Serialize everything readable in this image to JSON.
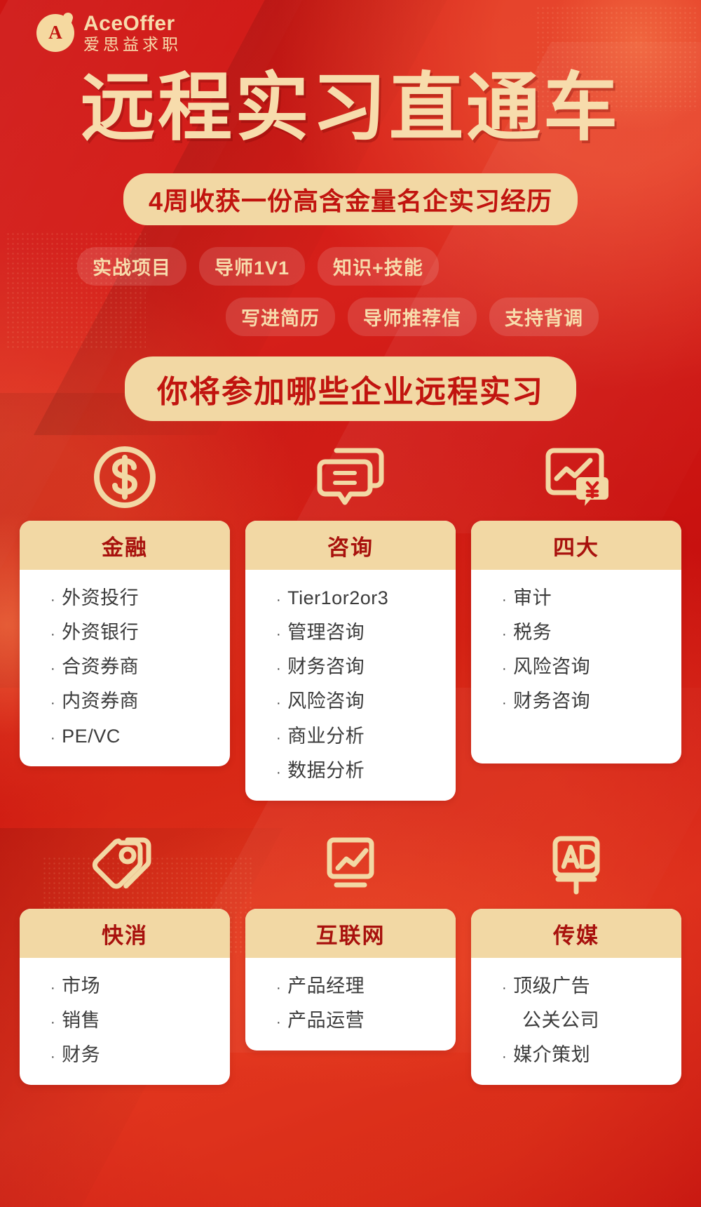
{
  "brand": {
    "mark_letter": "A",
    "name_en": "AceOffer",
    "name_cn": "爱思益求职"
  },
  "hero": {
    "main_title": "远程实习直通车",
    "subtitle": "4周收获一份高含金量名企实习经历",
    "tags_row1": [
      "实战项目",
      "导师1V1",
      "知识+技能"
    ],
    "tags_row2": [
      "写进简历",
      "导师推荐信",
      "支持背调"
    ]
  },
  "section": {
    "headline": "你将参加哪些企业远程实习"
  },
  "colors": {
    "background_red": "#d11a17",
    "cream": "#f2d8a4",
    "gold_text": "#f7dcac",
    "card_title_red": "#a8110d",
    "item_text": "#3b3b3b",
    "card_bg": "#ffffff"
  },
  "cards": [
    {
      "icon": "dollar-circle-icon",
      "title": "金融",
      "items": [
        {
          "text": "外资投行",
          "bullet": true
        },
        {
          "text": "外资银行",
          "bullet": true
        },
        {
          "text": "合资券商",
          "bullet": true
        },
        {
          "text": "内资券商",
          "bullet": true
        },
        {
          "text": "PE/VC",
          "bullet": true
        }
      ]
    },
    {
      "icon": "chat-bubbles-icon",
      "title": "咨询",
      "items": [
        {
          "text": "Tier1or2or3",
          "bullet": true
        },
        {
          "text": "管理咨询",
          "bullet": true
        },
        {
          "text": "财务咨询",
          "bullet": true
        },
        {
          "text": "风险咨询",
          "bullet": true
        },
        {
          "text": "商业分析",
          "bullet": true
        },
        {
          "text": "数据分析",
          "bullet": true
        }
      ]
    },
    {
      "icon": "chart-yen-icon",
      "title": "四大",
      "items": [
        {
          "text": "审计",
          "bullet": true
        },
        {
          "text": "税务",
          "bullet": true
        },
        {
          "text": "风险咨询",
          "bullet": true
        },
        {
          "text": "财务咨询",
          "bullet": true
        }
      ]
    },
    {
      "icon": "price-tag-icon",
      "title": "快消",
      "items": [
        {
          "text": "市场",
          "bullet": true
        },
        {
          "text": "销售",
          "bullet": true
        },
        {
          "text": "财务",
          "bullet": true
        }
      ]
    },
    {
      "icon": "chart-board-icon",
      "title": "互联网",
      "items": [
        {
          "text": "产品经理",
          "bullet": true
        },
        {
          "text": "产品运营",
          "bullet": true
        }
      ]
    },
    {
      "icon": "ad-board-icon",
      "title": "传媒",
      "items": [
        {
          "text": "顶级广告",
          "bullet": true
        },
        {
          "text": "公关公司",
          "bullet": false
        },
        {
          "text": "媒介策划",
          "bullet": true
        }
      ]
    }
  ]
}
